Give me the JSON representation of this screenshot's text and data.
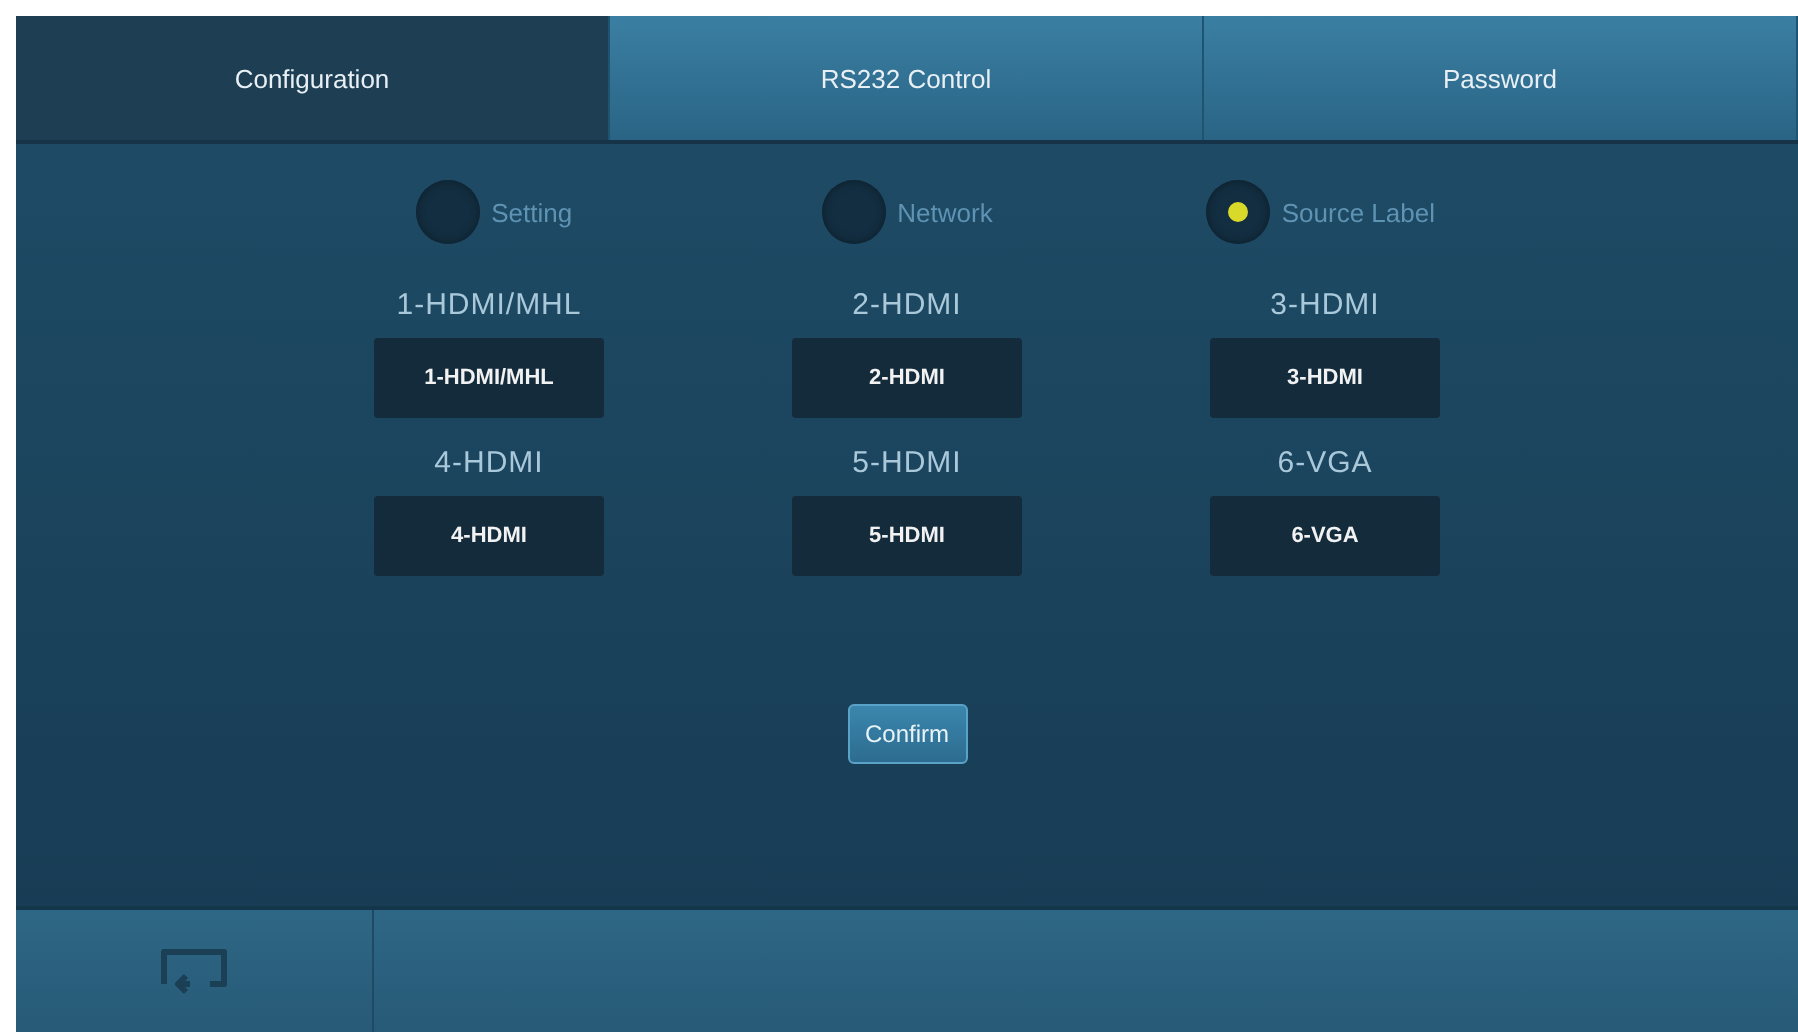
{
  "tabs": [
    {
      "label": "Configuration",
      "selected": true
    },
    {
      "label": "RS232 Control",
      "selected": false
    },
    {
      "label": "Password",
      "selected": false
    }
  ],
  "modes": [
    {
      "label": "Setting",
      "selected": false
    },
    {
      "label": "Network",
      "selected": false
    },
    {
      "label": "Source Label",
      "selected": true
    }
  ],
  "sources": [
    {
      "label": "1-HDMI/MHL",
      "value": "1-HDMI/MHL"
    },
    {
      "label": "2-HDMI",
      "value": "2-HDMI"
    },
    {
      "label": "3-HDMI",
      "value": "3-HDMI"
    },
    {
      "label": "4-HDMI",
      "value": "4-HDMI"
    },
    {
      "label": "5-HDMI",
      "value": "5-HDMI"
    },
    {
      "label": "6-VGA",
      "value": "6-VGA"
    }
  ],
  "confirm_button": "Confirm"
}
